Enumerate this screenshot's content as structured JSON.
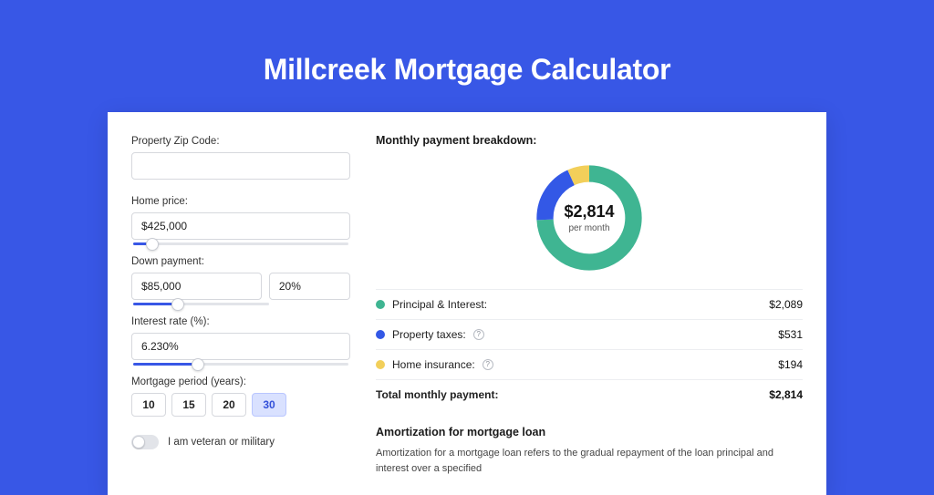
{
  "page": {
    "title": "Millcreek Mortgage Calculator"
  },
  "form": {
    "zip": {
      "label": "Property Zip Code:",
      "value": ""
    },
    "homePrice": {
      "label": "Home price:",
      "value": "$425,000",
      "slider_pct": 9
    },
    "downPayment": {
      "label": "Down payment:",
      "amount": "$85,000",
      "percent": "20%",
      "slider_pct": 20
    },
    "interestRate": {
      "label": "Interest rate (%):",
      "value": "6.230%",
      "slider_pct": 30
    },
    "period": {
      "label": "Mortgage period (years):",
      "options": [
        "10",
        "15",
        "20",
        "30"
      ],
      "selected": "30"
    },
    "veteran": {
      "label": "I am veteran or military",
      "on": false
    }
  },
  "breakdown": {
    "title": "Monthly payment breakdown:",
    "center_amount": "$2,814",
    "center_sub": "per month",
    "rows": [
      {
        "color": "green",
        "label": "Principal & Interest:",
        "value": "$2,089",
        "help": false
      },
      {
        "color": "blue",
        "label": "Property taxes:",
        "value": "$531",
        "help": true
      },
      {
        "color": "yellow",
        "label": "Home insurance:",
        "value": "$194",
        "help": true
      }
    ],
    "total_label": "Total monthly payment:",
    "total_value": "$2,814"
  },
  "amort": {
    "title": "Amortization for mortgage loan",
    "body": "Amortization for a mortgage loan refers to the gradual repayment of the loan principal and interest over a specified"
  },
  "chart_data": {
    "type": "pie",
    "title": "Monthly payment breakdown",
    "series": [
      {
        "name": "Principal & Interest",
        "value": 2089,
        "color": "#3fb592"
      },
      {
        "name": "Property taxes",
        "value": 531,
        "color": "#3358e6"
      },
      {
        "name": "Home insurance",
        "value": 194,
        "color": "#f2cf5a"
      }
    ],
    "total": 2814,
    "center_label": "$2,814 per month"
  }
}
